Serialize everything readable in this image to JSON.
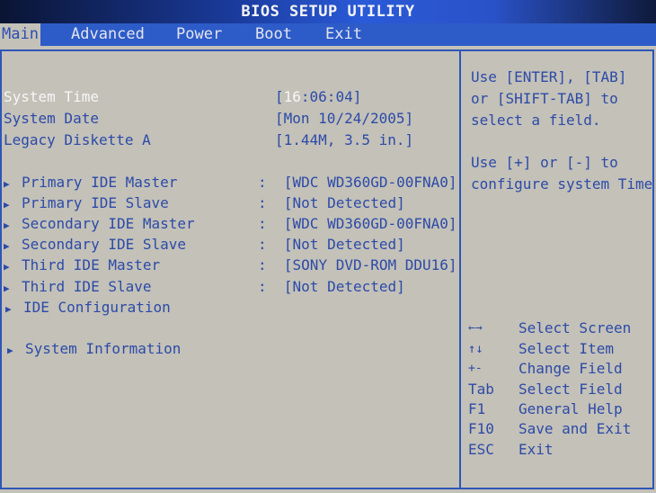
{
  "title": "BIOS SETUP UTILITY",
  "menu": {
    "tabs": [
      {
        "label": "Main",
        "active": true
      },
      {
        "label": "Advanced",
        "active": false
      },
      {
        "label": "Power",
        "active": false
      },
      {
        "label": "Boot",
        "active": false
      },
      {
        "label": "Exit",
        "active": false
      }
    ]
  },
  "settings": {
    "system_time": {
      "label": "System Time",
      "value_prefix": "[",
      "value_highlight": "16",
      "value_rest": ":06:04]"
    },
    "system_date": {
      "label": "System Date",
      "value": "[Mon 10/24/2005]"
    },
    "legacy_diskette": {
      "label": "Legacy Diskette A",
      "value": "[1.44M, 3.5 in.]"
    }
  },
  "submenus": [
    {
      "label": "Primary IDE Master",
      "value": "[WDC WD360GD-00FNA0]"
    },
    {
      "label": "Primary IDE Slave",
      "value": "[Not Detected]"
    },
    {
      "label": "Secondary IDE Master",
      "value": "[WDC WD360GD-00FNA0]"
    },
    {
      "label": "Secondary IDE Slave",
      "value": "[Not Detected]"
    },
    {
      "label": "Third IDE Master",
      "value": "[SONY DVD-ROM DDU16]"
    },
    {
      "label": "Third IDE Slave",
      "value": "[Not Detected]"
    },
    {
      "label": "IDE Configuration",
      "value": ""
    },
    {
      "label": "System Information",
      "value": ""
    }
  ],
  "separator": ":",
  "help": {
    "lines": [
      "Use [ENTER], [TAB]",
      "or [SHIFT-TAB] to",
      "select a field.",
      "",
      "Use [+] or [-] to",
      "configure system Time."
    ]
  },
  "keys": [
    {
      "key": "←→",
      "desc": "Select Screen"
    },
    {
      "key": "↑↓",
      "desc": "Select Item"
    },
    {
      "key": "+-",
      "desc": "Change Field"
    },
    {
      "key": "Tab",
      "desc": "Select Field"
    },
    {
      "key": "F1",
      "desc": "General Help"
    },
    {
      "key": "F10",
      "desc": "Save and Exit"
    },
    {
      "key": "ESC",
      "desc": "Exit"
    }
  ]
}
